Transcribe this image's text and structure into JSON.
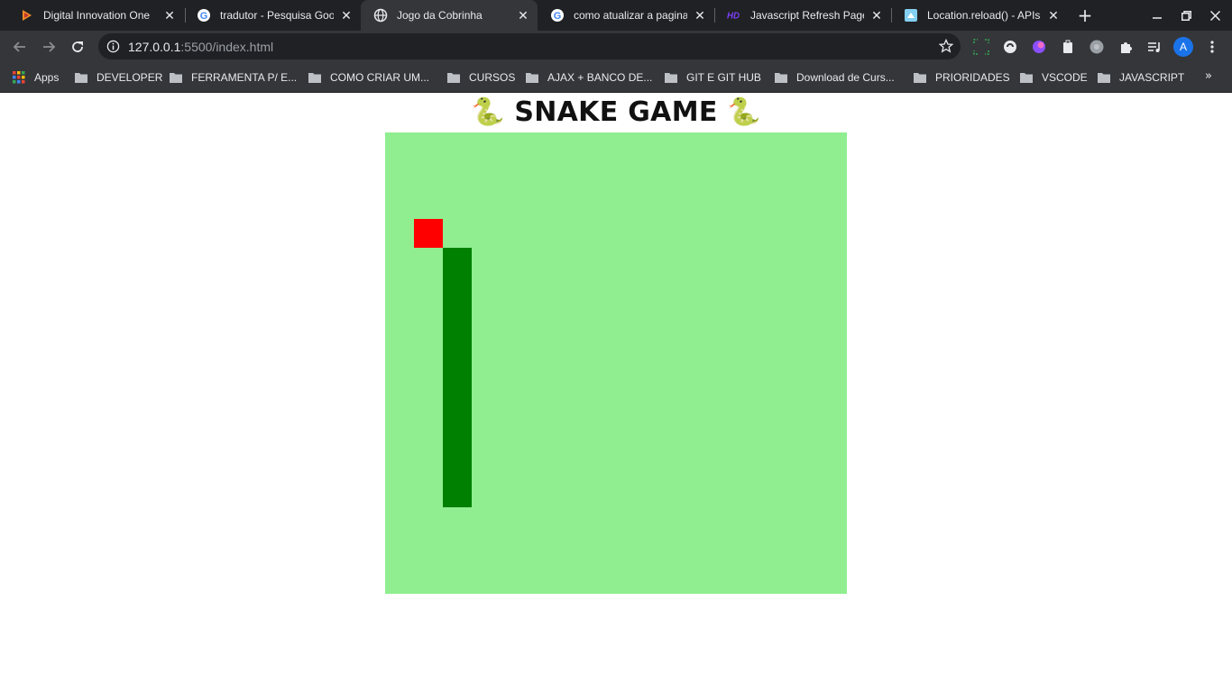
{
  "browser": {
    "tabs": [
      {
        "title": "Digital Innovation One",
        "icon": "dio-icon",
        "active": false
      },
      {
        "title": "tradutor - Pesquisa Goo",
        "icon": "google-icon",
        "active": false
      },
      {
        "title": "Jogo da Cobrinha",
        "icon": "globe-icon",
        "active": true
      },
      {
        "title": "como atualizar a pagina",
        "icon": "google-icon",
        "active": false
      },
      {
        "title": "Javascript Refresh Page",
        "icon": "hd-icon",
        "active": false
      },
      {
        "title": "Location.reload() - APIs",
        "icon": "mdn-icon",
        "active": false
      }
    ],
    "url_host": "127.0.0.1",
    "url_path": ":5500/index.html",
    "profile_initial": "A",
    "bookmarks": [
      {
        "label": "Apps",
        "icon": "apps-grid-icon"
      },
      {
        "label": "DEVELOPER",
        "icon": "folder-icon"
      },
      {
        "label": "FERRAMENTA P/ E...",
        "icon": "folder-icon"
      },
      {
        "label": "COMO CRIAR UM...",
        "icon": "folder-icon"
      },
      {
        "label": "CURSOS",
        "icon": "folder-icon"
      },
      {
        "label": "AJAX + BANCO DE...",
        "icon": "folder-icon"
      },
      {
        "label": "GIT E GIT HUB",
        "icon": "folder-icon"
      },
      {
        "label": "Download de Curs...",
        "icon": "folder-icon"
      },
      {
        "label": "PRIORIDADES",
        "icon": "folder-icon"
      },
      {
        "label": "VSCODE",
        "icon": "folder-icon"
      },
      {
        "label": "JAVASCRIPT",
        "icon": "folder-icon"
      }
    ],
    "bookmarks_more": "»"
  },
  "game": {
    "heading": "🐍 SNAKE GAME 🐍",
    "grid_cells": 16,
    "board_color": "#90ee90",
    "snake_color": "#008000",
    "food_color": "#ff0000",
    "food": {
      "col": 1,
      "row": 3
    },
    "snake": [
      {
        "col": 2,
        "row": 4
      },
      {
        "col": 2,
        "row": 5
      },
      {
        "col": 2,
        "row": 6
      },
      {
        "col": 2,
        "row": 7
      },
      {
        "col": 2,
        "row": 8
      },
      {
        "col": 2,
        "row": 9
      },
      {
        "col": 2,
        "row": 10
      },
      {
        "col": 2,
        "row": 11
      },
      {
        "col": 2,
        "row": 12
      }
    ]
  }
}
